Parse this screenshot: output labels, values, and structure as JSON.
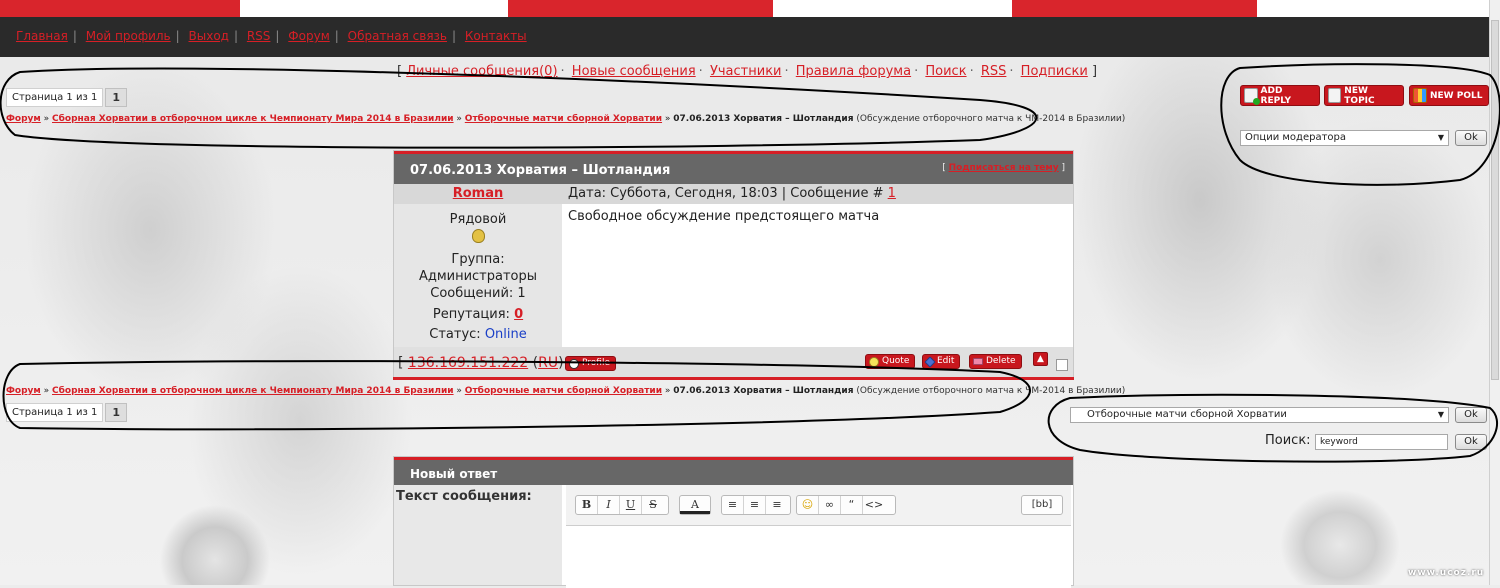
{
  "nav": {
    "links": [
      "Главная",
      "Мой профиль",
      "Выход",
      "RSS",
      "Форум",
      "Обратная связь",
      "Контакты"
    ]
  },
  "forum_links": {
    "open": "[",
    "close": "]",
    "items": [
      "Личные сообщения(0)",
      "Новые сообщения",
      "Участники",
      "Правила форума",
      "Поиск",
      "RSS",
      "Подписки"
    ]
  },
  "pager": {
    "label": "Страница 1 из 1",
    "page": "1"
  },
  "breadcrumb": {
    "forum": "Форум",
    "category": "Сборная Хорватии в отборочном цикле к Чемпионату Мира 2014 в Бразилии",
    "section": "Отборочные матчи сборной Хорватии",
    "topic": "07.06.2013 Хорватия – Шотландия",
    "description": "(Обсуждение отборочного матча к ЧМ-2014 в Бразилии)"
  },
  "actions": {
    "add_reply": "ADD REPLY",
    "new_topic": "NEW TOPIC",
    "new_poll": "NEW POLL"
  },
  "moderator": {
    "select": "Опции модератора",
    "ok": "Ok"
  },
  "post": {
    "title": "07.06.2013 Хорватия – Шотландия",
    "subscribe": "Подписаться на тему",
    "author": "Roman",
    "date_prefix": "Дата: Суббота, Сегодня, 18:03 | Сообщение #",
    "number": "1",
    "rank": "Рядовой",
    "group_label": "Группа:",
    "group": "Администраторы",
    "messages": "Сообщений: 1",
    "reputation_label": "Репутация:",
    "reputation": "0",
    "status_label": "Статус:",
    "status": "Online",
    "body": "Свободное обсуждение предстоящего матча",
    "ip": "136.169.151.222",
    "country": "RU",
    "profile": "Profile",
    "quote": "Quote",
    "edit": "Edit",
    "delete": "Delete"
  },
  "jump": {
    "select": "Отборочные матчи сборной Хорватии",
    "ok": "Ok"
  },
  "search": {
    "label": "Поиск:",
    "value": "keyword",
    "ok": "Ok"
  },
  "reply": {
    "title": "Новый ответ",
    "text_label": "Текст сообщения:",
    "bb": "[bb]"
  },
  "watermark": "www.ucoz.ru"
}
